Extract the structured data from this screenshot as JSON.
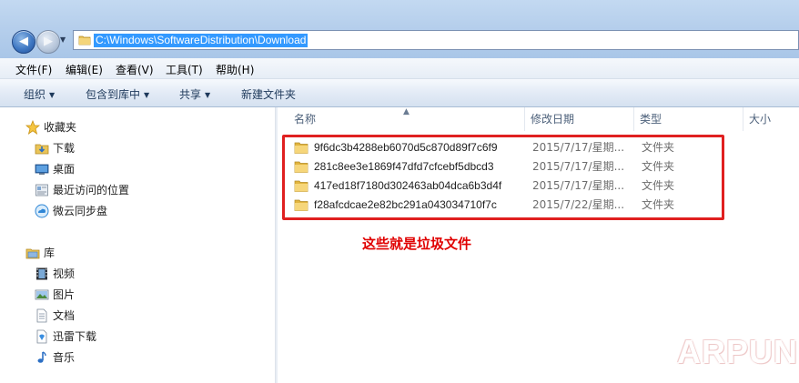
{
  "address": {
    "path": "C:\\Windows\\SoftwareDistribution\\Download"
  },
  "menu": {
    "file": "文件(F)",
    "edit": "编辑(E)",
    "view": "查看(V)",
    "tools": "工具(T)",
    "help": "帮助(H)"
  },
  "toolbar": {
    "organize": "组织",
    "include_in_library": "包含到库中",
    "share": "共享",
    "new_folder": "新建文件夹"
  },
  "nav": {
    "favorites": {
      "header": "收藏夹",
      "items": [
        {
          "label": "下载",
          "icon": "download-folder-icon"
        },
        {
          "label": "桌面",
          "icon": "desktop-icon"
        },
        {
          "label": "最近访问的位置",
          "icon": "recent-places-icon"
        },
        {
          "label": "微云同步盘",
          "icon": "weiyun-icon"
        }
      ]
    },
    "libraries": {
      "header": "库",
      "items": [
        {
          "label": "视频",
          "icon": "video-icon"
        },
        {
          "label": "图片",
          "icon": "picture-icon"
        },
        {
          "label": "文档",
          "icon": "document-icon"
        },
        {
          "label": "迅雷下载",
          "icon": "xunlei-icon"
        },
        {
          "label": "音乐",
          "icon": "music-icon"
        }
      ]
    }
  },
  "columns": {
    "name": "名称",
    "modified": "修改日期",
    "type": "类型",
    "size": "大小"
  },
  "files": [
    {
      "name": "9f6dc3b4288eb6070d5c870d89f7c6f9",
      "date": "2015/7/17/星期...",
      "type": "文件夹"
    },
    {
      "name": "281c8ee3e1869f47dfd7cfcebf5dbcd3",
      "date": "2015/7/17/星期...",
      "type": "文件夹"
    },
    {
      "name": "417ed18f7180d302463ab04dca6b3d4f",
      "date": "2015/7/17/星期...",
      "type": "文件夹"
    },
    {
      "name": "f28afcdcae2e82bc291a043034710f7c",
      "date": "2015/7/22/星期...",
      "type": "文件夹"
    }
  ],
  "annotation": "这些就是垃圾文件",
  "watermark": "ARPUN",
  "colors": {
    "annotation": "#e00000",
    "highlight_box": "#e02020",
    "address_selection": "#3399ff"
  }
}
